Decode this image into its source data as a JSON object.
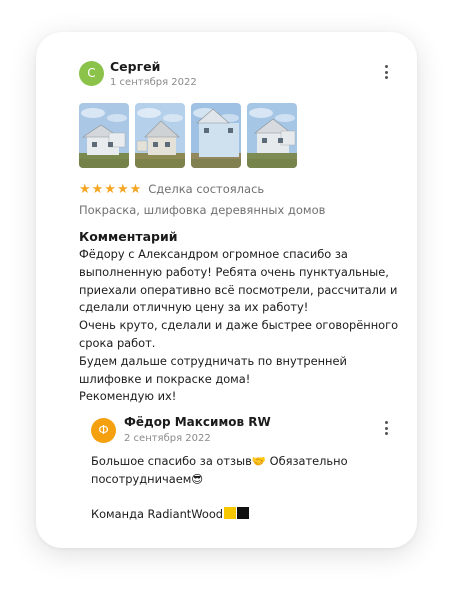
{
  "review": {
    "author": "Сергей",
    "author_initial": "С",
    "date": "1 сентября 2022",
    "avatar_color": "#8bc34a",
    "photos": [
      {
        "name": "house-photo-1",
        "sky": "#aac8e6",
        "ground": "#7a8a4e",
        "wall": "#e8ecef",
        "roof": "#d4d8dc"
      },
      {
        "name": "house-photo-2",
        "sky": "#b5d0ea",
        "ground": "#8c8a52",
        "wall": "#e4e1d8",
        "roof": "#cfd2d4"
      },
      {
        "name": "house-photo-3",
        "sky": "#9fc1e3",
        "ground": "#93875e",
        "wall": "#cfe0ee",
        "roof": "#dfe5ea"
      },
      {
        "name": "house-photo-4",
        "sky": "#a6c6e6",
        "ground": "#7e8c53",
        "wall": "#e6eaec",
        "roof": "#d7dbdf"
      }
    ],
    "stars": "★★★★★",
    "star_color": "#f5a623",
    "deal_status": "Сделка состоялась",
    "service": "Покраска, шлифовка деревянных домов",
    "comment_title": "Комментарий",
    "comment_lines": [
      "Фёдору с Александром огромное спасибо за",
      "выполненную работу! Ребята очень пунктуальные,",
      "приехали оперативно всё посмотрели, рассчитали и",
      "сделали отличную цену за их работу!",
      "Очень круто, сделали и даже быстрее оговорённого",
      "срока работ.",
      "Будем дальше сотрудничать по внутренней",
      "шлифовке и покраске дома!",
      "Рекомендую их!"
    ]
  },
  "reply": {
    "author": "Фёдор Максимов RW",
    "author_initial": "Ф",
    "date": "2 сентября 2022",
    "avatar_color": "#f5a00f",
    "line1": "Большое спасибо за отзыв",
    "emoji1": "🤝",
    "line1_rest": " Обязательно",
    "line2": "посотрудничаем",
    "emoji2": "😎",
    "signature": "Команда RadiantWood",
    "signature_colors": [
      "#f7c800",
      "#111111"
    ]
  }
}
